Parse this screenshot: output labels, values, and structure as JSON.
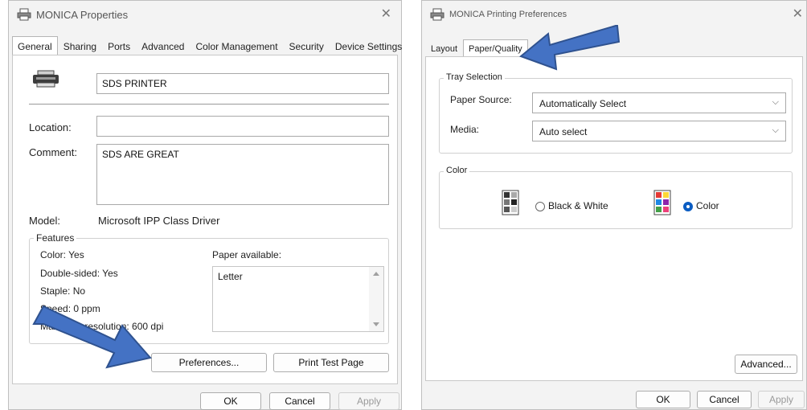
{
  "left_window": {
    "title": "MONICA Properties",
    "tabs": [
      "General",
      "Sharing",
      "Ports",
      "Advanced",
      "Color Management",
      "Security",
      "Device Settings"
    ],
    "printer_name": "SDS PRINTER",
    "location_label": "Location:",
    "location_value": "",
    "comment_label": "Comment:",
    "comment_value": "SDS ARE GREAT",
    "model_label": "Model:",
    "model_value": "Microsoft IPP Class Driver",
    "features_label": "Features",
    "color": "Color: Yes",
    "double_sided": "Double-sided: Yes",
    "staple": "Staple: No",
    "speed": "Speed: 0 ppm",
    "max_resolution": "Maximum resolution: 600 dpi",
    "paper_available_label": "Paper available:",
    "paper_list": [
      "Letter"
    ],
    "preferences_button": "Preferences...",
    "print_test_button": "Print Test Page",
    "ok_button": "OK",
    "cancel_button": "Cancel",
    "apply_button": "Apply"
  },
  "right_window": {
    "title": "MONICA Printing Preferences",
    "tabs": [
      "Layout",
      "Paper/Quality"
    ],
    "tray_selection_label": "Tray Selection",
    "paper_source_label": "Paper Source:",
    "paper_source_value": "Automatically Select",
    "media_label": "Media:",
    "media_value": "Auto select",
    "color_label": "Color",
    "bw_option": "Black & White",
    "color_option": "Color",
    "selected_color_mode": "Color",
    "advanced_button": "Advanced...",
    "ok_button": "OK",
    "cancel_button": "Cancel",
    "apply_button": "Apply"
  },
  "icons": {
    "title_icon": "printer-icon",
    "device_icon": "printer-device-icon",
    "bw_icon": "black-white-document-icon",
    "color_icon": "color-document-icon",
    "arrow": "blue-arrow-annotation"
  },
  "colors": {
    "accent": "#0a5cc2",
    "arrow_fill": "#4472c4",
    "arrow_stroke": "#2f528f"
  }
}
